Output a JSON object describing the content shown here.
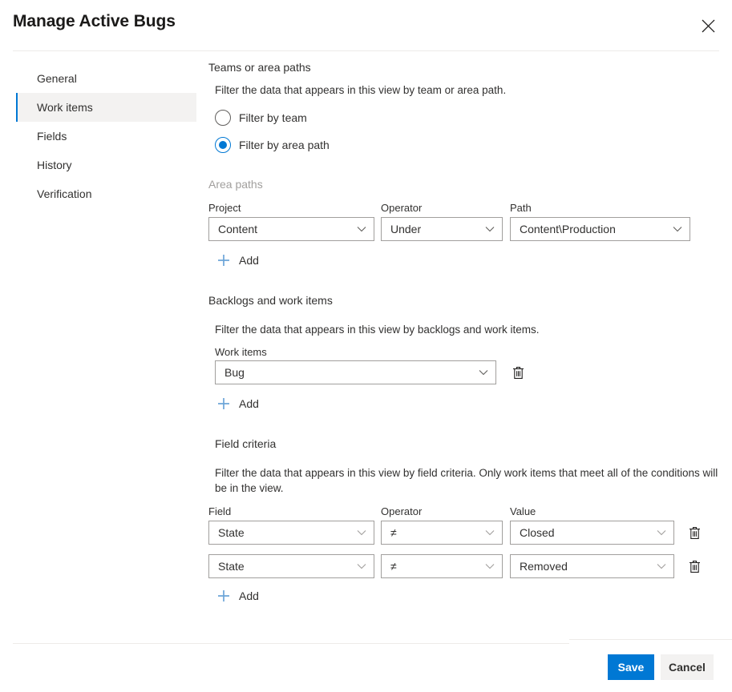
{
  "dialog": {
    "title": "Manage Active Bugs",
    "close_icon": "close-icon"
  },
  "sidebar": {
    "items": [
      {
        "label": "General",
        "selected": false
      },
      {
        "label": "Work items",
        "selected": true
      },
      {
        "label": "Fields",
        "selected": false
      },
      {
        "label": "History",
        "selected": false
      },
      {
        "label": "Verification",
        "selected": false
      }
    ]
  },
  "teams_or_area_paths": {
    "heading": "Teams or area paths",
    "description": "Filter the data that appears in this view by team or area path.",
    "radios": [
      {
        "label": "Filter by team",
        "checked": false
      },
      {
        "label": "Filter by area path",
        "checked": true
      }
    ]
  },
  "area_paths": {
    "group_label": "Area paths",
    "columns": [
      "Project",
      "Operator",
      "Path"
    ],
    "rows": [
      {
        "project": "Content",
        "operator": "Under",
        "path": "Content\\Production"
      }
    ],
    "add_label": "Add",
    "add_icon": "plus-icon"
  },
  "backlogs_and_work_items": {
    "heading": "Backlogs and work items",
    "description": "Filter the data that appears in this view by backlogs and work items.",
    "field_label": "Work items",
    "rows": [
      {
        "value": "Bug",
        "delete_icon": "trash-icon"
      }
    ],
    "add_label": "Add",
    "add_icon": "plus-icon"
  },
  "field_criteria": {
    "heading": "Field criteria",
    "description": "Filter the data that appears in this view by field criteria. Only work items that meet all of the conditions will be in the view.",
    "columns": [
      "Field",
      "Operator",
      "Value"
    ],
    "rows": [
      {
        "field": "State",
        "operator": "≠",
        "value": "Closed",
        "delete_icon": "trash-icon"
      },
      {
        "field": "State",
        "operator": "≠",
        "value": "Removed",
        "delete_icon": "trash-icon"
      }
    ],
    "add_label": "Add",
    "add_icon": "plus-icon"
  },
  "footer": {
    "save_label": "Save",
    "cancel_label": "Cancel"
  },
  "colors": {
    "accent": "#0078d4",
    "selected_nav_bg": "#f3f2f1",
    "border": "#a19f9d",
    "divider": "#edebe9",
    "text": "#323130",
    "muted_text": "#a19f9d",
    "add_icon": "#6ca5d8",
    "cancel_bg": "#f3f2f1"
  }
}
